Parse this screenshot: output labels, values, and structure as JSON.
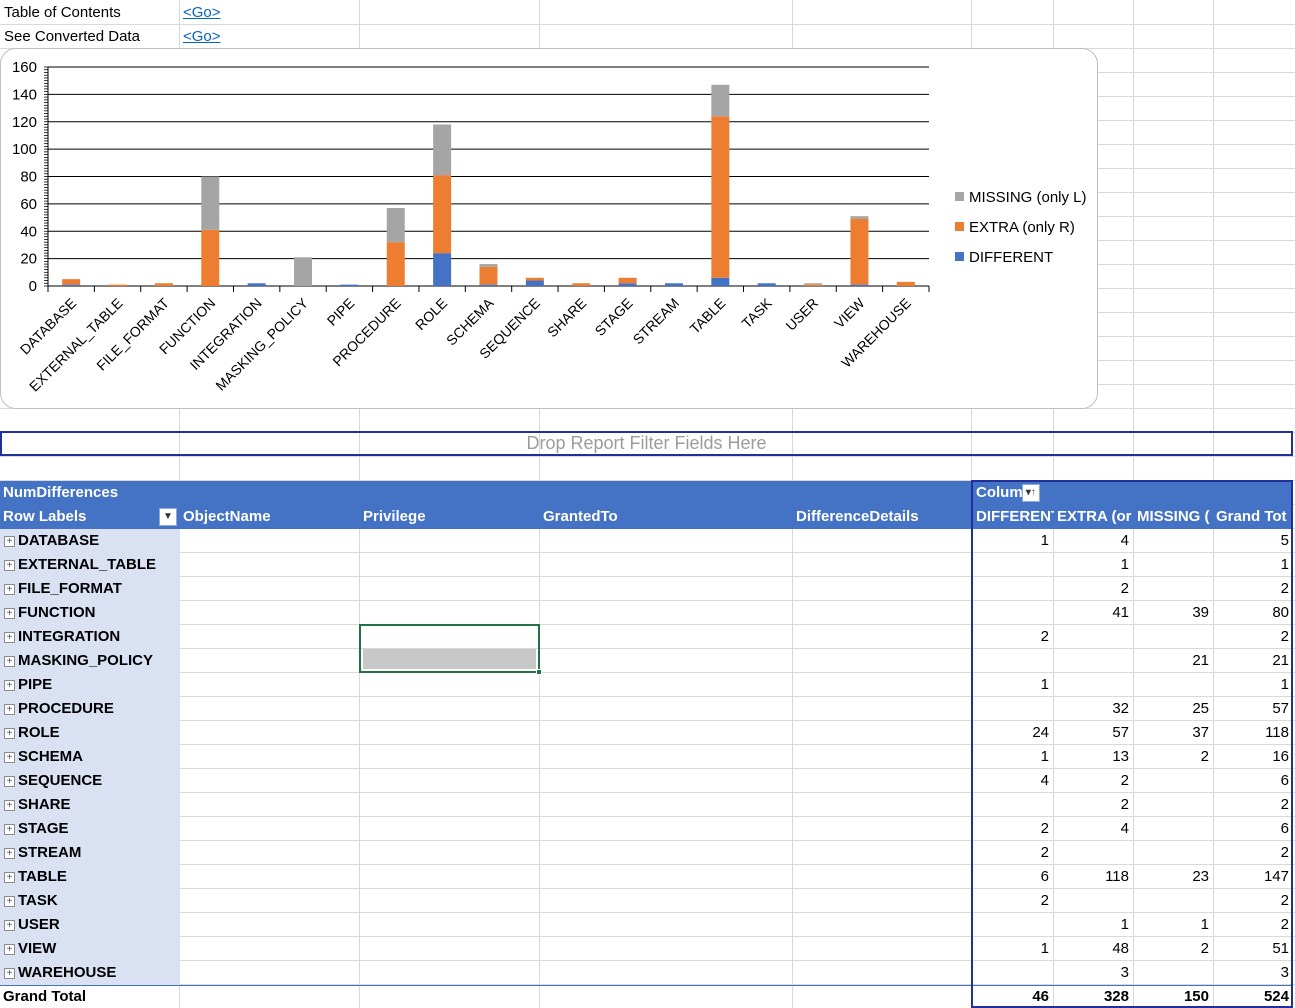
{
  "nav": [
    {
      "label": "Table of Contents",
      "link": "<Go>"
    },
    {
      "label": "See Converted Data",
      "link": "<Go>"
    }
  ],
  "filter_placeholder": "Drop Report Filter Fields Here",
  "pivot": {
    "values_header": "NumDifferences",
    "columns_header": "Column",
    "row_labels_header": "Row Labels",
    "field_headers": [
      "ObjectName",
      "Privilege",
      "GrantedTo",
      "DifferenceDetails"
    ],
    "value_columns": [
      "DIFFERENT",
      "EXTRA (or",
      "MISSING (",
      "Grand Tot"
    ],
    "rows": [
      {
        "label": "DATABASE",
        "values": [
          "1",
          "4",
          "",
          "5"
        ]
      },
      {
        "label": "EXTERNAL_TABLE",
        "values": [
          "",
          "1",
          "",
          "1"
        ]
      },
      {
        "label": "FILE_FORMAT",
        "values": [
          "",
          "2",
          "",
          "2"
        ]
      },
      {
        "label": "FUNCTION",
        "values": [
          "",
          "41",
          "39",
          "80"
        ]
      },
      {
        "label": "INTEGRATION",
        "values": [
          "2",
          "",
          "",
          "2"
        ]
      },
      {
        "label": "MASKING_POLICY",
        "values": [
          "",
          "",
          "21",
          "21"
        ]
      },
      {
        "label": "PIPE",
        "values": [
          "1",
          "",
          "",
          "1"
        ]
      },
      {
        "label": "PROCEDURE",
        "values": [
          "",
          "32",
          "25",
          "57"
        ]
      },
      {
        "label": "ROLE",
        "values": [
          "24",
          "57",
          "37",
          "118"
        ]
      },
      {
        "label": "SCHEMA",
        "values": [
          "1",
          "13",
          "2",
          "16"
        ]
      },
      {
        "label": "SEQUENCE",
        "values": [
          "4",
          "2",
          "",
          "6"
        ]
      },
      {
        "label": "SHARE",
        "values": [
          "",
          "2",
          "",
          "2"
        ]
      },
      {
        "label": "STAGE",
        "values": [
          "2",
          "4",
          "",
          "6"
        ]
      },
      {
        "label": "STREAM",
        "values": [
          "2",
          "",
          "",
          "2"
        ]
      },
      {
        "label": "TABLE",
        "values": [
          "6",
          "118",
          "23",
          "147"
        ]
      },
      {
        "label": "TASK",
        "values": [
          "2",
          "",
          "",
          "2"
        ]
      },
      {
        "label": "USER",
        "values": [
          "",
          "1",
          "1",
          "2"
        ]
      },
      {
        "label": "VIEW",
        "values": [
          "1",
          "48",
          "2",
          "51"
        ]
      },
      {
        "label": "WAREHOUSE",
        "values": [
          "",
          "3",
          "",
          "3"
        ]
      }
    ],
    "grand_total": {
      "label": "Grand Total",
      "values": [
        "46",
        "328",
        "150",
        "524"
      ]
    }
  },
  "chart_data": {
    "type": "bar",
    "stacked": true,
    "categories": [
      "DATABASE",
      "EXTERNAL_TABLE",
      "FILE_FORMAT",
      "FUNCTION",
      "INTEGRATION",
      "MASKING_POLICY",
      "PIPE",
      "PROCEDURE",
      "ROLE",
      "SCHEMA",
      "SEQUENCE",
      "SHARE",
      "STAGE",
      "STREAM",
      "TABLE",
      "TASK",
      "USER",
      "VIEW",
      "WAREHOUSE"
    ],
    "series": [
      {
        "name": "DIFFERENT",
        "color": "#4472c4",
        "values": [
          1,
          0,
          0,
          0,
          2,
          0,
          1,
          0,
          24,
          1,
          4,
          0,
          2,
          2,
          6,
          2,
          0,
          1,
          0
        ]
      },
      {
        "name": "EXTRA (only R)",
        "color": "#ed7d31",
        "values": [
          4,
          1,
          2,
          41,
          0,
          0,
          0,
          32,
          57,
          13,
          2,
          2,
          4,
          0,
          118,
          0,
          1,
          48,
          3
        ]
      },
      {
        "name": "MISSING (only L)",
        "color": "#a5a5a5",
        "values": [
          0,
          0,
          0,
          39,
          0,
          21,
          0,
          25,
          37,
          2,
          0,
          0,
          0,
          0,
          23,
          0,
          1,
          2,
          0
        ]
      }
    ],
    "legend_order": [
      "MISSING (only L)",
      "EXTRA (only R)",
      "DIFFERENT"
    ],
    "legend_position": "right",
    "ylim": [
      0,
      160
    ],
    "yticks": [
      0,
      20,
      40,
      60,
      80,
      100,
      120,
      140,
      160
    ],
    "grid": true
  }
}
